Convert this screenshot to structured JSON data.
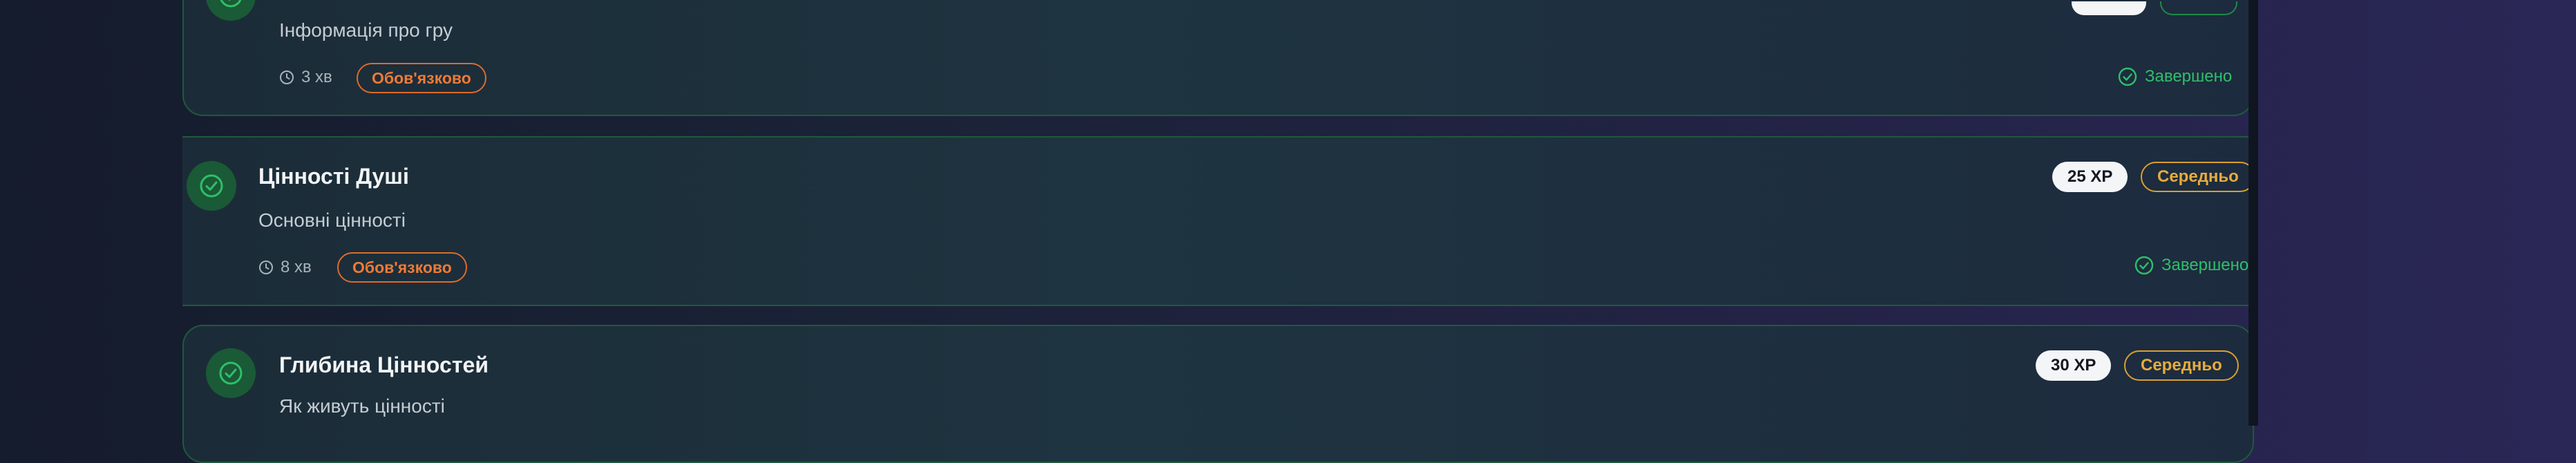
{
  "lessons": [
    {
      "description": "Інформація про гру",
      "duration": "3 хв",
      "required_label": "Обов'язково",
      "status_label": "Завершено"
    },
    {
      "title": "Цінності Душі",
      "description": "Основні цінності",
      "duration": "8 хв",
      "required_label": "Обов'язково",
      "xp": "25 XP",
      "difficulty": "Середньо",
      "status_label": "Завершено"
    },
    {
      "title": "Глибина Цінностей",
      "description": "Як живуть цінності",
      "xp": "30 XP",
      "difficulty": "Середньо"
    }
  ],
  "colors": {
    "completed_green": "#2fbf6a",
    "required_orange": "#ef7a36",
    "difficulty_amber": "#e6ac3c"
  },
  "icons": {
    "completed": "check-circle-icon",
    "duration": "clock-icon"
  }
}
